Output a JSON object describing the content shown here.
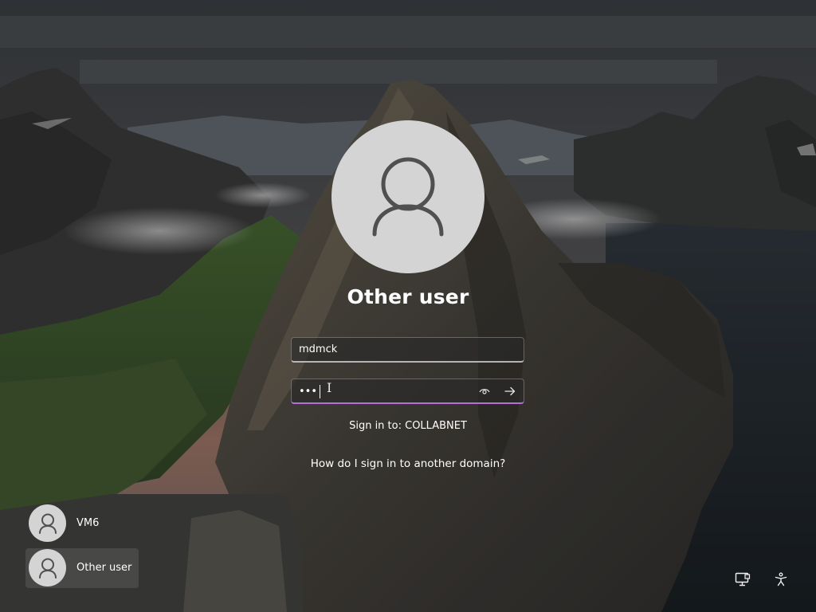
{
  "background": {
    "sky_top": "#3a3c40",
    "sunset": "#9a6a55",
    "mountain": "#2f2e2c",
    "grass": "#3f5a2c",
    "water": "#1e2429"
  },
  "login": {
    "user_name": "Other user",
    "username_value": "mdmck",
    "password_mask": "•••",
    "sign_in_to": "Sign in to: COLLABNET",
    "other_domain_link": "How do I sign in to another domain?",
    "accent_color": "#b76fd8",
    "icons": {
      "avatar": "user-silhouette-icon",
      "reveal": "eye-icon",
      "submit": "arrow-right-icon"
    }
  },
  "user_list": [
    {
      "label": "VM6",
      "icon": "user-silhouette-icon"
    },
    {
      "label": "Other user",
      "icon": "user-silhouette-icon",
      "selected": true
    }
  ],
  "corner_icons": {
    "network": "network-icon",
    "accessibility": "accessibility-icon"
  }
}
